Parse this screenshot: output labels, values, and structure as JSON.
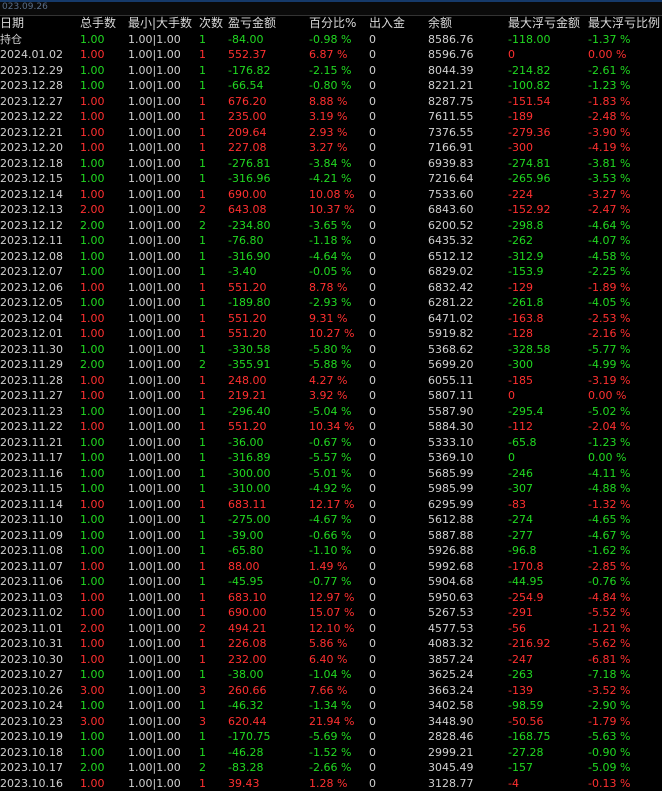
{
  "top_strip_label": "023.09.26",
  "headers": [
    "日期",
    "总手数",
    "最小|大手数",
    "次数",
    "盈亏金额",
    "百分比%",
    "出入金",
    "余额",
    "最大浮亏金额",
    "最大浮亏比例"
  ],
  "holding": {
    "label": "持仓",
    "lots": "1.00",
    "minmax": "1.00|1.00",
    "count": "1",
    "pnl": "-84.00",
    "pct": "-0.98 %",
    "io": "0",
    "balance": "8586.76",
    "maxdd": "-118.00",
    "maxdd_pct": "-1.37 %",
    "color": "green"
  },
  "rows": [
    {
      "date": "2024.01.02",
      "lots": "1.00",
      "minmax": "1.00|1.00",
      "count": "1",
      "pnl": "552.37",
      "pct": "6.87 %",
      "io": "0",
      "balance": "8596.76",
      "maxdd": "0",
      "maxdd_pct": "0.00 %",
      "color": "red"
    },
    {
      "date": "2023.12.29",
      "lots": "1.00",
      "minmax": "1.00|1.00",
      "count": "1",
      "pnl": "-176.82",
      "pct": "-2.15 %",
      "io": "0",
      "balance": "8044.39",
      "maxdd": "-214.82",
      "maxdd_pct": "-2.61 %",
      "color": "green"
    },
    {
      "date": "2023.12.28",
      "lots": "1.00",
      "minmax": "1.00|1.00",
      "count": "1",
      "pnl": "-66.54",
      "pct": "-0.80 %",
      "io": "0",
      "balance": "8221.21",
      "maxdd": "-100.82",
      "maxdd_pct": "-1.23 %",
      "color": "green"
    },
    {
      "date": "2023.12.27",
      "lots": "1.00",
      "minmax": "1.00|1.00",
      "count": "1",
      "pnl": "676.20",
      "pct": "8.88 %",
      "io": "0",
      "balance": "8287.75",
      "maxdd": "-151.54",
      "maxdd_pct": "-1.83 %",
      "color": "red"
    },
    {
      "date": "2023.12.22",
      "lots": "1.00",
      "minmax": "1.00|1.00",
      "count": "1",
      "pnl": "235.00",
      "pct": "3.19 %",
      "io": "0",
      "balance": "7611.55",
      "maxdd": "-189",
      "maxdd_pct": "-2.48 %",
      "color": "red"
    },
    {
      "date": "2023.12.21",
      "lots": "1.00",
      "minmax": "1.00|1.00",
      "count": "1",
      "pnl": "209.64",
      "pct": "2.93 %",
      "io": "0",
      "balance": "7376.55",
      "maxdd": "-279.36",
      "maxdd_pct": "-3.90 %",
      "color": "red"
    },
    {
      "date": "2023.12.20",
      "lots": "1.00",
      "minmax": "1.00|1.00",
      "count": "1",
      "pnl": "227.08",
      "pct": "3.27 %",
      "io": "0",
      "balance": "7166.91",
      "maxdd": "-300",
      "maxdd_pct": "-4.19 %",
      "color": "red"
    },
    {
      "date": "2023.12.18",
      "lots": "1.00",
      "minmax": "1.00|1.00",
      "count": "1",
      "pnl": "-276.81",
      "pct": "-3.84 %",
      "io": "0",
      "balance": "6939.83",
      "maxdd": "-274.81",
      "maxdd_pct": "-3.81 %",
      "color": "green"
    },
    {
      "date": "2023.12.15",
      "lots": "1.00",
      "minmax": "1.00|1.00",
      "count": "1",
      "pnl": "-316.96",
      "pct": "-4.21 %",
      "io": "0",
      "balance": "7216.64",
      "maxdd": "-265.96",
      "maxdd_pct": "-3.53 %",
      "color": "green"
    },
    {
      "date": "2023.12.14",
      "lots": "1.00",
      "minmax": "1.00|1.00",
      "count": "1",
      "pnl": "690.00",
      "pct": "10.08 %",
      "io": "0",
      "balance": "7533.60",
      "maxdd": "-224",
      "maxdd_pct": "-3.27 %",
      "color": "red"
    },
    {
      "date": "2023.12.13",
      "lots": "2.00",
      "minmax": "1.00|1.00",
      "count": "2",
      "pnl": "643.08",
      "pct": "10.37 %",
      "io": "0",
      "balance": "6843.60",
      "maxdd": "-152.92",
      "maxdd_pct": "-2.47 %",
      "color": "red"
    },
    {
      "date": "2023.12.12",
      "lots": "2.00",
      "minmax": "1.00|1.00",
      "count": "2",
      "pnl": "-234.80",
      "pct": "-3.65 %",
      "io": "0",
      "balance": "6200.52",
      "maxdd": "-298.8",
      "maxdd_pct": "-4.64 %",
      "color": "green"
    },
    {
      "date": "2023.12.11",
      "lots": "1.00",
      "minmax": "1.00|1.00",
      "count": "1",
      "pnl": "-76.80",
      "pct": "-1.18 %",
      "io": "0",
      "balance": "6435.32",
      "maxdd": "-262",
      "maxdd_pct": "-4.07 %",
      "color": "green"
    },
    {
      "date": "2023.12.08",
      "lots": "1.00",
      "minmax": "1.00|1.00",
      "count": "1",
      "pnl": "-316.90",
      "pct": "-4.64 %",
      "io": "0",
      "balance": "6512.12",
      "maxdd": "-312.9",
      "maxdd_pct": "-4.58 %",
      "color": "green"
    },
    {
      "date": "2023.12.07",
      "lots": "1.00",
      "minmax": "1.00|1.00",
      "count": "1",
      "pnl": "-3.40",
      "pct": "-0.05 %",
      "io": "0",
      "balance": "6829.02",
      "maxdd": "-153.9",
      "maxdd_pct": "-2.25 %",
      "color": "green"
    },
    {
      "date": "2023.12.06",
      "lots": "1.00",
      "minmax": "1.00|1.00",
      "count": "1",
      "pnl": "551.20",
      "pct": "8.78 %",
      "io": "0",
      "balance": "6832.42",
      "maxdd": "-129",
      "maxdd_pct": "-1.89 %",
      "color": "red"
    },
    {
      "date": "2023.12.05",
      "lots": "1.00",
      "minmax": "1.00|1.00",
      "count": "1",
      "pnl": "-189.80",
      "pct": "-2.93 %",
      "io": "0",
      "balance": "6281.22",
      "maxdd": "-261.8",
      "maxdd_pct": "-4.05 %",
      "color": "green"
    },
    {
      "date": "2023.12.04",
      "lots": "1.00",
      "minmax": "1.00|1.00",
      "count": "1",
      "pnl": "551.20",
      "pct": "9.31 %",
      "io": "0",
      "balance": "6471.02",
      "maxdd": "-163.8",
      "maxdd_pct": "-2.53 %",
      "color": "red"
    },
    {
      "date": "2023.12.01",
      "lots": "1.00",
      "minmax": "1.00|1.00",
      "count": "1",
      "pnl": "551.20",
      "pct": "10.27 %",
      "io": "0",
      "balance": "5919.82",
      "maxdd": "-128",
      "maxdd_pct": "-2.16 %",
      "color": "red"
    },
    {
      "date": "2023.11.30",
      "lots": "1.00",
      "minmax": "1.00|1.00",
      "count": "1",
      "pnl": "-330.58",
      "pct": "-5.80 %",
      "io": "0",
      "balance": "5368.62",
      "maxdd": "-328.58",
      "maxdd_pct": "-5.77 %",
      "color": "green"
    },
    {
      "date": "2023.11.29",
      "lots": "2.00",
      "minmax": "1.00|1.00",
      "count": "2",
      "pnl": "-355.91",
      "pct": "-5.88 %",
      "io": "0",
      "balance": "5699.20",
      "maxdd": "-300",
      "maxdd_pct": "-4.99 %",
      "color": "green"
    },
    {
      "date": "2023.11.28",
      "lots": "1.00",
      "minmax": "1.00|1.00",
      "count": "1",
      "pnl": "248.00",
      "pct": "4.27 %",
      "io": "0",
      "balance": "6055.11",
      "maxdd": "-185",
      "maxdd_pct": "-3.19 %",
      "color": "red"
    },
    {
      "date": "2023.11.27",
      "lots": "1.00",
      "minmax": "1.00|1.00",
      "count": "1",
      "pnl": "219.21",
      "pct": "3.92 %",
      "io": "0",
      "balance": "5807.11",
      "maxdd": "0",
      "maxdd_pct": "0.00 %",
      "color": "red"
    },
    {
      "date": "2023.11.23",
      "lots": "1.00",
      "minmax": "1.00|1.00",
      "count": "1",
      "pnl": "-296.40",
      "pct": "-5.04 %",
      "io": "0",
      "balance": "5587.90",
      "maxdd": "-295.4",
      "maxdd_pct": "-5.02 %",
      "color": "green"
    },
    {
      "date": "2023.11.22",
      "lots": "1.00",
      "minmax": "1.00|1.00",
      "count": "1",
      "pnl": "551.20",
      "pct": "10.34 %",
      "io": "0",
      "balance": "5884.30",
      "maxdd": "-112",
      "maxdd_pct": "-2.04 %",
      "color": "red"
    },
    {
      "date": "2023.11.21",
      "lots": "1.00",
      "minmax": "1.00|1.00",
      "count": "1",
      "pnl": "-36.00",
      "pct": "-0.67 %",
      "io": "0",
      "balance": "5333.10",
      "maxdd": "-65.8",
      "maxdd_pct": "-1.23 %",
      "color": "green"
    },
    {
      "date": "2023.11.17",
      "lots": "1.00",
      "minmax": "1.00|1.00",
      "count": "1",
      "pnl": "-316.89",
      "pct": "-5.57 %",
      "io": "0",
      "balance": "5369.10",
      "maxdd": "0",
      "maxdd_pct": "0.00 %",
      "color": "green"
    },
    {
      "date": "2023.11.16",
      "lots": "1.00",
      "minmax": "1.00|1.00",
      "count": "1",
      "pnl": "-300.00",
      "pct": "-5.01 %",
      "io": "0",
      "balance": "5685.99",
      "maxdd": "-246",
      "maxdd_pct": "-4.11 %",
      "color": "green"
    },
    {
      "date": "2023.11.15",
      "lots": "1.00",
      "minmax": "1.00|1.00",
      "count": "1",
      "pnl": "-310.00",
      "pct": "-4.92 %",
      "io": "0",
      "balance": "5985.99",
      "maxdd": "-307",
      "maxdd_pct": "-4.88 %",
      "color": "green"
    },
    {
      "date": "2023.11.14",
      "lots": "1.00",
      "minmax": "1.00|1.00",
      "count": "1",
      "pnl": "683.11",
      "pct": "12.17 %",
      "io": "0",
      "balance": "6295.99",
      "maxdd": "-83",
      "maxdd_pct": "-1.32 %",
      "color": "red"
    },
    {
      "date": "2023.11.10",
      "lots": "1.00",
      "minmax": "1.00|1.00",
      "count": "1",
      "pnl": "-275.00",
      "pct": "-4.67 %",
      "io": "0",
      "balance": "5612.88",
      "maxdd": "-274",
      "maxdd_pct": "-4.65 %",
      "color": "green"
    },
    {
      "date": "2023.11.09",
      "lots": "1.00",
      "minmax": "1.00|1.00",
      "count": "1",
      "pnl": "-39.00",
      "pct": "-0.66 %",
      "io": "0",
      "balance": "5887.88",
      "maxdd": "-277",
      "maxdd_pct": "-4.67 %",
      "color": "green"
    },
    {
      "date": "2023.11.08",
      "lots": "1.00",
      "minmax": "1.00|1.00",
      "count": "1",
      "pnl": "-65.80",
      "pct": "-1.10 %",
      "io": "0",
      "balance": "5926.88",
      "maxdd": "-96.8",
      "maxdd_pct": "-1.62 %",
      "color": "green"
    },
    {
      "date": "2023.11.07",
      "lots": "1.00",
      "minmax": "1.00|1.00",
      "count": "1",
      "pnl": "88.00",
      "pct": "1.49 %",
      "io": "0",
      "balance": "5992.68",
      "maxdd": "-170.8",
      "maxdd_pct": "-2.85 %",
      "color": "red"
    },
    {
      "date": "2023.11.06",
      "lots": "1.00",
      "minmax": "1.00|1.00",
      "count": "1",
      "pnl": "-45.95",
      "pct": "-0.77 %",
      "io": "0",
      "balance": "5904.68",
      "maxdd": "-44.95",
      "maxdd_pct": "-0.76 %",
      "color": "green"
    },
    {
      "date": "2023.11.03",
      "lots": "1.00",
      "minmax": "1.00|1.00",
      "count": "1",
      "pnl": "683.10",
      "pct": "12.97 %",
      "io": "0",
      "balance": "5950.63",
      "maxdd": "-254.9",
      "maxdd_pct": "-4.84 %",
      "color": "red"
    },
    {
      "date": "2023.11.02",
      "lots": "1.00",
      "minmax": "1.00|1.00",
      "count": "1",
      "pnl": "690.00",
      "pct": "15.07 %",
      "io": "0",
      "balance": "5267.53",
      "maxdd": "-291",
      "maxdd_pct": "-5.52 %",
      "color": "red"
    },
    {
      "date": "2023.11.01",
      "lots": "2.00",
      "minmax": "1.00|1.00",
      "count": "2",
      "pnl": "494.21",
      "pct": "12.10 %",
      "io": "0",
      "balance": "4577.53",
      "maxdd": "-56",
      "maxdd_pct": "-1.21 %",
      "color": "red"
    },
    {
      "date": "2023.10.31",
      "lots": "1.00",
      "minmax": "1.00|1.00",
      "count": "1",
      "pnl": "226.08",
      "pct": "5.86 %",
      "io": "0",
      "balance": "4083.32",
      "maxdd": "-216.92",
      "maxdd_pct": "-5.62 %",
      "color": "red"
    },
    {
      "date": "2023.10.30",
      "lots": "1.00",
      "minmax": "1.00|1.00",
      "count": "1",
      "pnl": "232.00",
      "pct": "6.40 %",
      "io": "0",
      "balance": "3857.24",
      "maxdd": "-247",
      "maxdd_pct": "-6.81 %",
      "color": "red"
    },
    {
      "date": "2023.10.27",
      "lots": "1.00",
      "minmax": "1.00|1.00",
      "count": "1",
      "pnl": "-38.00",
      "pct": "-1.04 %",
      "io": "0",
      "balance": "3625.24",
      "maxdd": "-263",
      "maxdd_pct": "-7.18 %",
      "color": "green"
    },
    {
      "date": "2023.10.26",
      "lots": "3.00",
      "minmax": "1.00|1.00",
      "count": "3",
      "pnl": "260.66",
      "pct": "7.66 %",
      "io": "0",
      "balance": "3663.24",
      "maxdd": "-139",
      "maxdd_pct": "-3.52 %",
      "color": "red"
    },
    {
      "date": "2023.10.24",
      "lots": "1.00",
      "minmax": "1.00|1.00",
      "count": "1",
      "pnl": "-46.32",
      "pct": "-1.34 %",
      "io": "0",
      "balance": "3402.58",
      "maxdd": "-98.59",
      "maxdd_pct": "-2.90 %",
      "color": "green"
    },
    {
      "date": "2023.10.23",
      "lots": "3.00",
      "minmax": "1.00|1.00",
      "count": "3",
      "pnl": "620.44",
      "pct": "21.94 %",
      "io": "0",
      "balance": "3448.90",
      "maxdd": "-50.56",
      "maxdd_pct": "-1.79 %",
      "color": "red"
    },
    {
      "date": "2023.10.19",
      "lots": "1.00",
      "minmax": "1.00|1.00",
      "count": "1",
      "pnl": "-170.75",
      "pct": "-5.69 %",
      "io": "0",
      "balance": "2828.46",
      "maxdd": "-168.75",
      "maxdd_pct": "-5.63 %",
      "color": "green"
    },
    {
      "date": "2023.10.18",
      "lots": "1.00",
      "minmax": "1.00|1.00",
      "count": "1",
      "pnl": "-46.28",
      "pct": "-1.52 %",
      "io": "0",
      "balance": "2999.21",
      "maxdd": "-27.28",
      "maxdd_pct": "-0.90 %",
      "color": "green"
    },
    {
      "date": "2023.10.17",
      "lots": "2.00",
      "minmax": "1.00|1.00",
      "count": "2",
      "pnl": "-83.28",
      "pct": "-2.66 %",
      "io": "0",
      "balance": "3045.49",
      "maxdd": "-157",
      "maxdd_pct": "-5.09 %",
      "color": "green"
    },
    {
      "date": "2023.10.16",
      "lots": "1.00",
      "minmax": "1.00|1.00",
      "count": "1",
      "pnl": "39.43",
      "pct": "1.28 %",
      "io": "0",
      "balance": "3128.77",
      "maxdd": "-4",
      "maxdd_pct": "-0.13 %",
      "color": "red"
    }
  ],
  "colors": {
    "background": "#000000",
    "profit": "#ff3030",
    "loss": "#21d821",
    "neutral": "#d0d0d0"
  }
}
